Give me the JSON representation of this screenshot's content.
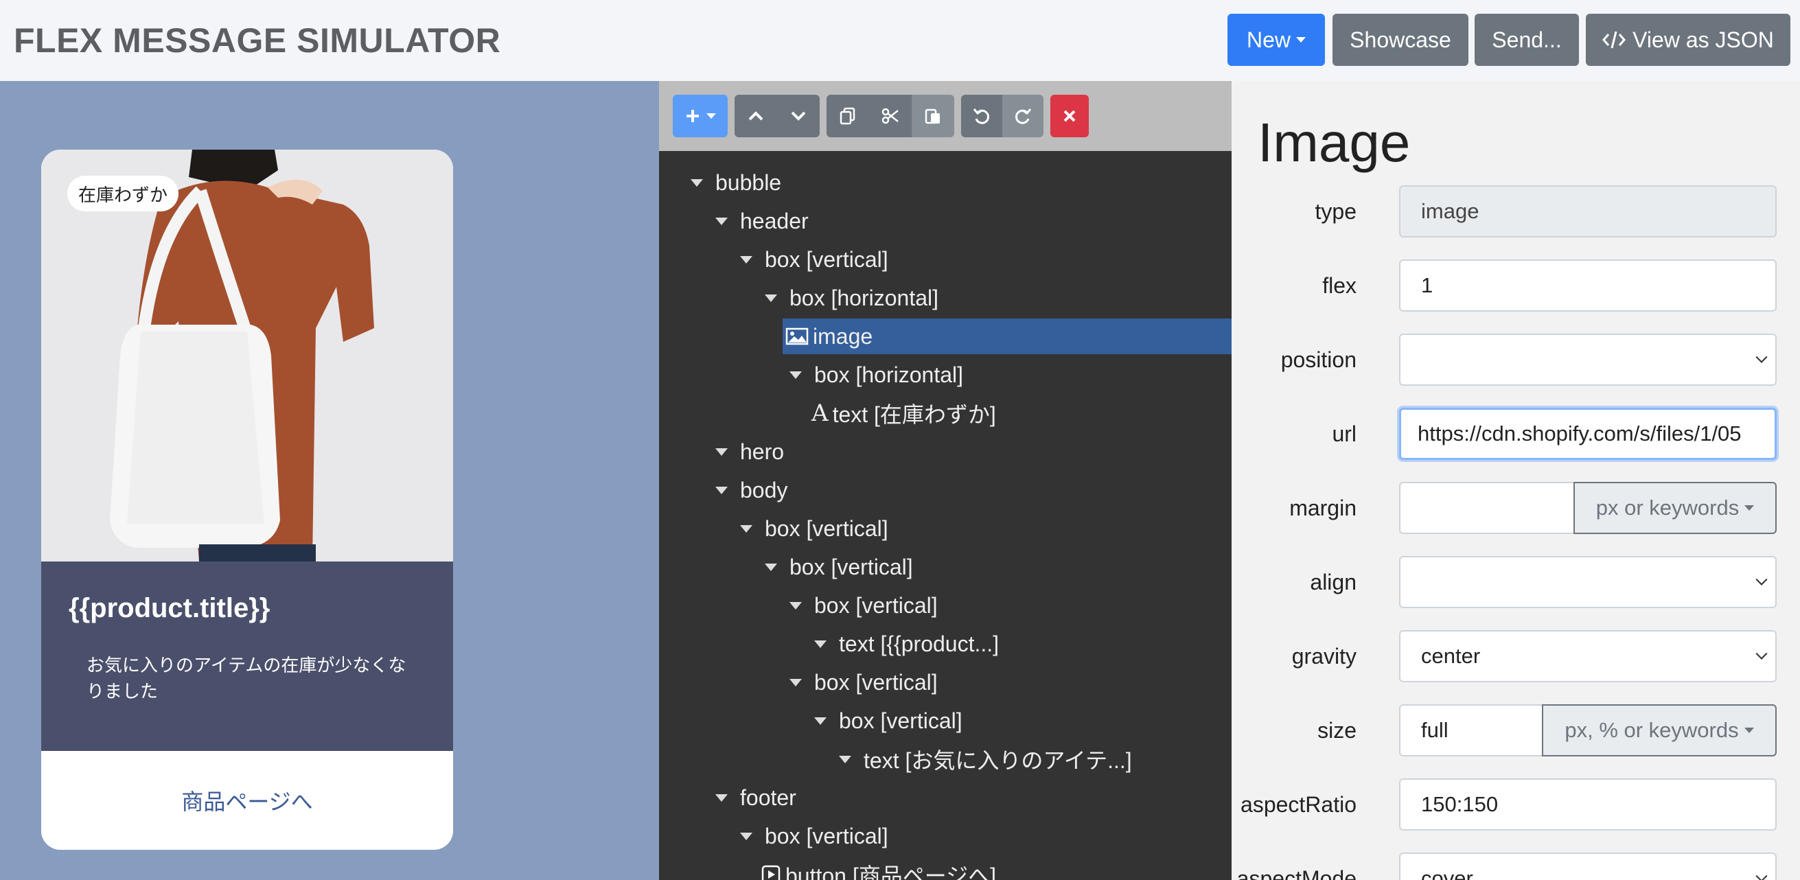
{
  "header": {
    "title": "FLEX MESSAGE SIMULATOR",
    "buttons": {
      "new": "New",
      "showcase": "Showcase",
      "send": "Send...",
      "view_json": "View as JSON"
    }
  },
  "preview": {
    "badge": "在庫わずか",
    "product_title": "{{product.title}}",
    "description": "お気に入りのアイテムの在庫が少なくなりました",
    "footer_button": "商品ページへ"
  },
  "tree": {
    "nodes": [
      {
        "label": "bubble"
      },
      {
        "label": "header"
      },
      {
        "label": "box [vertical]"
      },
      {
        "label": "box [horizontal]"
      },
      {
        "label": "image"
      },
      {
        "label": "box [horizontal]"
      },
      {
        "label": "text [在庫わずか]"
      },
      {
        "label": "hero"
      },
      {
        "label": "body"
      },
      {
        "label": "box [vertical]"
      },
      {
        "label": "box [vertical]"
      },
      {
        "label": "box [vertical]"
      },
      {
        "label": "text [{{product...]"
      },
      {
        "label": "box [vertical]"
      },
      {
        "label": "box [vertical]"
      },
      {
        "label": "text [お気に入りのアイテ...]"
      },
      {
        "label": "footer"
      },
      {
        "label": "box [vertical]"
      },
      {
        "label": "button [商品ページへ]"
      }
    ]
  },
  "properties": {
    "title": "Image",
    "fields": {
      "type": {
        "label": "type",
        "value": "image"
      },
      "flex": {
        "label": "flex",
        "value": "1"
      },
      "position": {
        "label": "position",
        "value": ""
      },
      "url": {
        "label": "url",
        "value": "https://cdn.shopify.com/s/files/1/05"
      },
      "margin": {
        "label": "margin",
        "value": "",
        "addon": "px or keywords"
      },
      "align": {
        "label": "align",
        "value": ""
      },
      "gravity": {
        "label": "gravity",
        "value": "center"
      },
      "size": {
        "label": "size",
        "value": "full",
        "addon": "px, % or keywords"
      },
      "aspectRatio": {
        "label": "aspectRatio",
        "value": "150:150"
      },
      "aspectMode": {
        "label": "aspectMode",
        "value": "cover"
      }
    }
  },
  "colors": {
    "primary": "#2f7cf6",
    "secondary": "#6c757d",
    "danger": "#dc3545",
    "preview_bg": "#879dbf",
    "card_body": "#4a506b",
    "tree_bg": "#333333",
    "tree_selected": "#355f9b"
  }
}
